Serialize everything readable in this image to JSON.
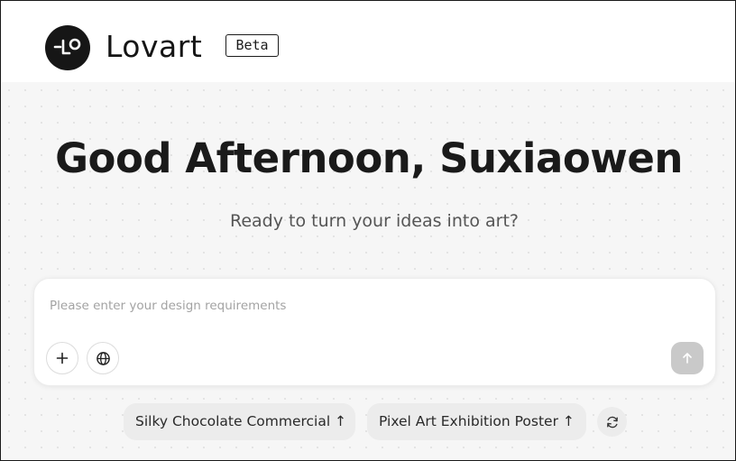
{
  "header": {
    "brand": "Lovart",
    "badge": "Beta",
    "logo_icon": "lovart-logo-icon"
  },
  "main": {
    "greeting": "Good Afternoon, Suxiaowen",
    "subtitle": "Ready to turn your ideas into art?"
  },
  "prompt": {
    "placeholder": "Please enter your design requirements",
    "value": "",
    "add_icon": "plus-icon",
    "web_icon": "globe-icon",
    "send_icon": "arrow-up-icon"
  },
  "suggestions": [
    {
      "label": "Silky Chocolate Commercial",
      "icon": "arrow-up-icon"
    },
    {
      "label": "Pixel Art Exhibition Poster",
      "icon": "arrow-up-icon"
    }
  ],
  "refresh_icon": "refresh-icon",
  "colors": {
    "background": "#f6f6f6",
    "card": "#ffffff",
    "chip": "#ececec",
    "send_disabled": "#c9c9c9",
    "text": "#1a1a1a"
  }
}
